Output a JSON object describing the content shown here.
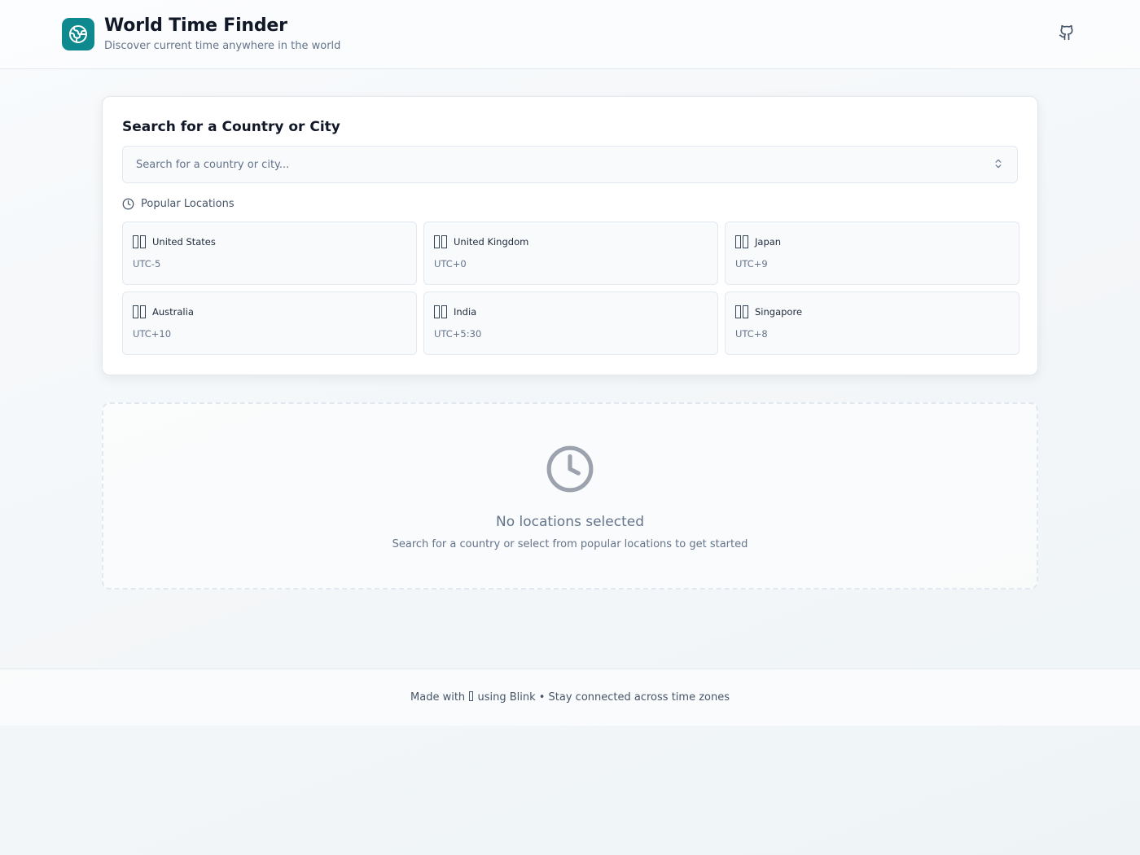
{
  "header": {
    "title": "World Time Finder",
    "subtitle": "Discover current time anywhere in the world",
    "logo_icon": "globe-icon",
    "github_icon": "github-icon"
  },
  "search": {
    "heading": "Search for a Country or City",
    "placeholder": "Search for a country or city...",
    "dropdown_icon": "chevrons-up-down-icon"
  },
  "popular": {
    "label": "Popular Locations",
    "icon": "clock-icon",
    "locations": [
      {
        "name": "United States",
        "offset": "UTC-5"
      },
      {
        "name": "United Kingdom",
        "offset": "UTC+0"
      },
      {
        "name": "Japan",
        "offset": "UTC+9"
      },
      {
        "name": "Australia",
        "offset": "UTC+10"
      },
      {
        "name": "India",
        "offset": "UTC+5:30"
      },
      {
        "name": "Singapore",
        "offset": "UTC+8"
      }
    ]
  },
  "empty_state": {
    "icon": "clock-icon",
    "title": "No locations selected",
    "subtitle": "Search for a country or select from popular locations to get started"
  },
  "footer": {
    "prefix": "Made with",
    "suffix": "using Blink • Stay connected across time zones"
  },
  "colors": {
    "accent": "#0e8a8f",
    "text": "#111827",
    "muted": "#64748b",
    "border": "#e2e8f0"
  }
}
